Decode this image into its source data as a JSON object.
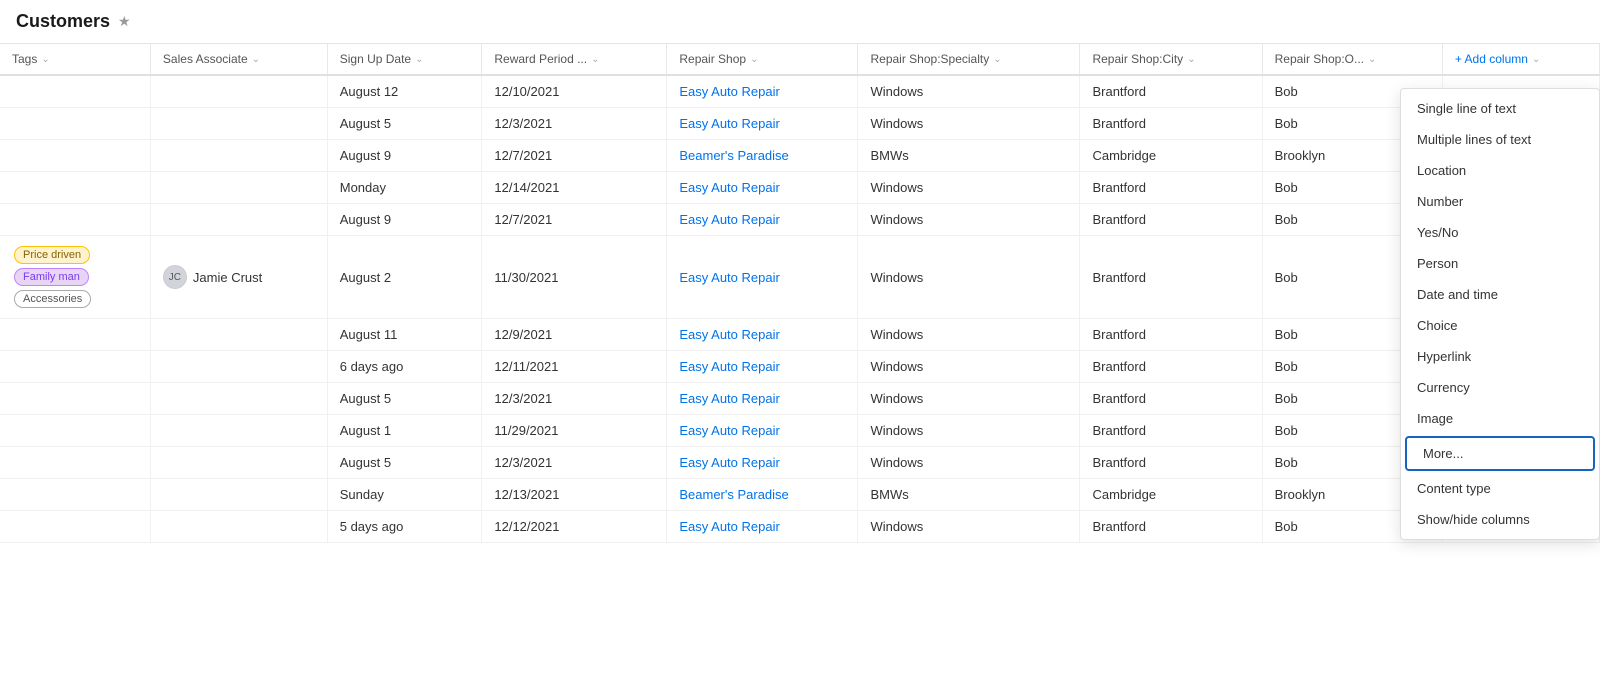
{
  "header": {
    "title": "Customers",
    "star_label": "★"
  },
  "columns": [
    {
      "id": "tags",
      "label": "Tags"
    },
    {
      "id": "sales_associate",
      "label": "Sales Associate"
    },
    {
      "id": "sign_up_date",
      "label": "Sign Up Date"
    },
    {
      "id": "reward_period",
      "label": "Reward Period ..."
    },
    {
      "id": "repair_shop",
      "label": "Repair Shop"
    },
    {
      "id": "repair_shop_specialty",
      "label": "Repair Shop:Specialty"
    },
    {
      "id": "repair_shop_city",
      "label": "Repair Shop:City"
    },
    {
      "id": "repair_shop_o",
      "label": "Repair Shop:O..."
    },
    {
      "id": "add_column",
      "label": "+ Add column"
    }
  ],
  "rows": [
    {
      "tags": "",
      "sales_associate": "",
      "sign_up_date": "August 12",
      "reward_period": "12/10/2021",
      "repair_shop": "Easy Auto Repair",
      "repair_shop_specialty": "Windows",
      "repair_shop_city": "Brantford",
      "repair_shop_o": "Bob"
    },
    {
      "tags": "",
      "sales_associate": "",
      "sign_up_date": "August 5",
      "reward_period": "12/3/2021",
      "repair_shop": "Easy Auto Repair",
      "repair_shop_specialty": "Windows",
      "repair_shop_city": "Brantford",
      "repair_shop_o": "Bob"
    },
    {
      "tags": "",
      "sales_associate": "",
      "sign_up_date": "August 9",
      "reward_period": "12/7/2021",
      "repair_shop": "Beamer's Paradise",
      "repair_shop_specialty": "BMWs",
      "repair_shop_city": "Cambridge",
      "repair_shop_o": "Brooklyn"
    },
    {
      "tags": "",
      "sales_associate": "",
      "sign_up_date": "Monday",
      "reward_period": "12/14/2021",
      "repair_shop": "Easy Auto Repair",
      "repair_shop_specialty": "Windows",
      "repair_shop_city": "Brantford",
      "repair_shop_o": "Bob"
    },
    {
      "tags": "",
      "sales_associate": "",
      "sign_up_date": "August 9",
      "reward_period": "12/7/2021",
      "repair_shop": "Easy Auto Repair",
      "repair_shop_specialty": "Windows",
      "repair_shop_city": "Brantford",
      "repair_shop_o": "Bob"
    },
    {
      "tags": "tagged",
      "sales_associate": "Jamie Crust",
      "sign_up_date": "August 2",
      "reward_period": "11/30/2021",
      "repair_shop": "Easy Auto Repair",
      "repair_shop_specialty": "Windows",
      "repair_shop_city": "Brantford",
      "repair_shop_o": "Bob"
    },
    {
      "tags": "",
      "sales_associate": "",
      "sign_up_date": "August 11",
      "reward_period": "12/9/2021",
      "repair_shop": "Easy Auto Repair",
      "repair_shop_specialty": "Windows",
      "repair_shop_city": "Brantford",
      "repair_shop_o": "Bob"
    },
    {
      "tags": "",
      "sales_associate": "",
      "sign_up_date": "6 days ago",
      "reward_period": "12/11/2021",
      "repair_shop": "Easy Auto Repair",
      "repair_shop_specialty": "Windows",
      "repair_shop_city": "Brantford",
      "repair_shop_o": "Bob"
    },
    {
      "tags": "",
      "sales_associate": "",
      "sign_up_date": "August 5",
      "reward_period": "12/3/2021",
      "repair_shop": "Easy Auto Repair",
      "repair_shop_specialty": "Windows",
      "repair_shop_city": "Brantford",
      "repair_shop_o": "Bob"
    },
    {
      "tags": "",
      "sales_associate": "",
      "sign_up_date": "August 1",
      "reward_period": "11/29/2021",
      "repair_shop": "Easy Auto Repair",
      "repair_shop_specialty": "Windows",
      "repair_shop_city": "Brantford",
      "repair_shop_o": "Bob"
    },
    {
      "tags": "",
      "sales_associate": "",
      "sign_up_date": "August 5",
      "reward_period": "12/3/2021",
      "repair_shop": "Easy Auto Repair",
      "repair_shop_specialty": "Windows",
      "repair_shop_city": "Brantford",
      "repair_shop_o": "Bob"
    },
    {
      "tags": "",
      "sales_associate": "",
      "sign_up_date": "Sunday",
      "reward_period": "12/13/2021",
      "repair_shop": "Beamer's Paradise",
      "repair_shop_specialty": "BMWs",
      "repair_shop_city": "Cambridge",
      "repair_shop_o": "Brooklyn"
    },
    {
      "tags": "",
      "sales_associate": "",
      "sign_up_date": "5 days ago",
      "reward_period": "12/12/2021",
      "repair_shop": "Easy Auto Repair",
      "repair_shop_specialty": "Windows",
      "repair_shop_city": "Brantford",
      "repair_shop_o": "Bob"
    }
  ],
  "dropdown": {
    "items": [
      {
        "label": "Single line of text",
        "highlighted": false
      },
      {
        "label": "Multiple lines of text",
        "highlighted": false
      },
      {
        "label": "Location",
        "highlighted": false
      },
      {
        "label": "Number",
        "highlighted": false
      },
      {
        "label": "Yes/No",
        "highlighted": false
      },
      {
        "label": "Person",
        "highlighted": false
      },
      {
        "label": "Date and time",
        "highlighted": false
      },
      {
        "label": "Choice",
        "highlighted": false
      },
      {
        "label": "Hyperlink",
        "highlighted": false
      },
      {
        "label": "Currency",
        "highlighted": false
      },
      {
        "label": "Image",
        "highlighted": false
      },
      {
        "label": "More...",
        "highlighted": true
      },
      {
        "label": "Content type",
        "highlighted": false
      },
      {
        "label": "Show/hide columns",
        "highlighted": false
      }
    ]
  },
  "tags_row5": [
    "Price driven",
    "Family man",
    "Accessories"
  ]
}
